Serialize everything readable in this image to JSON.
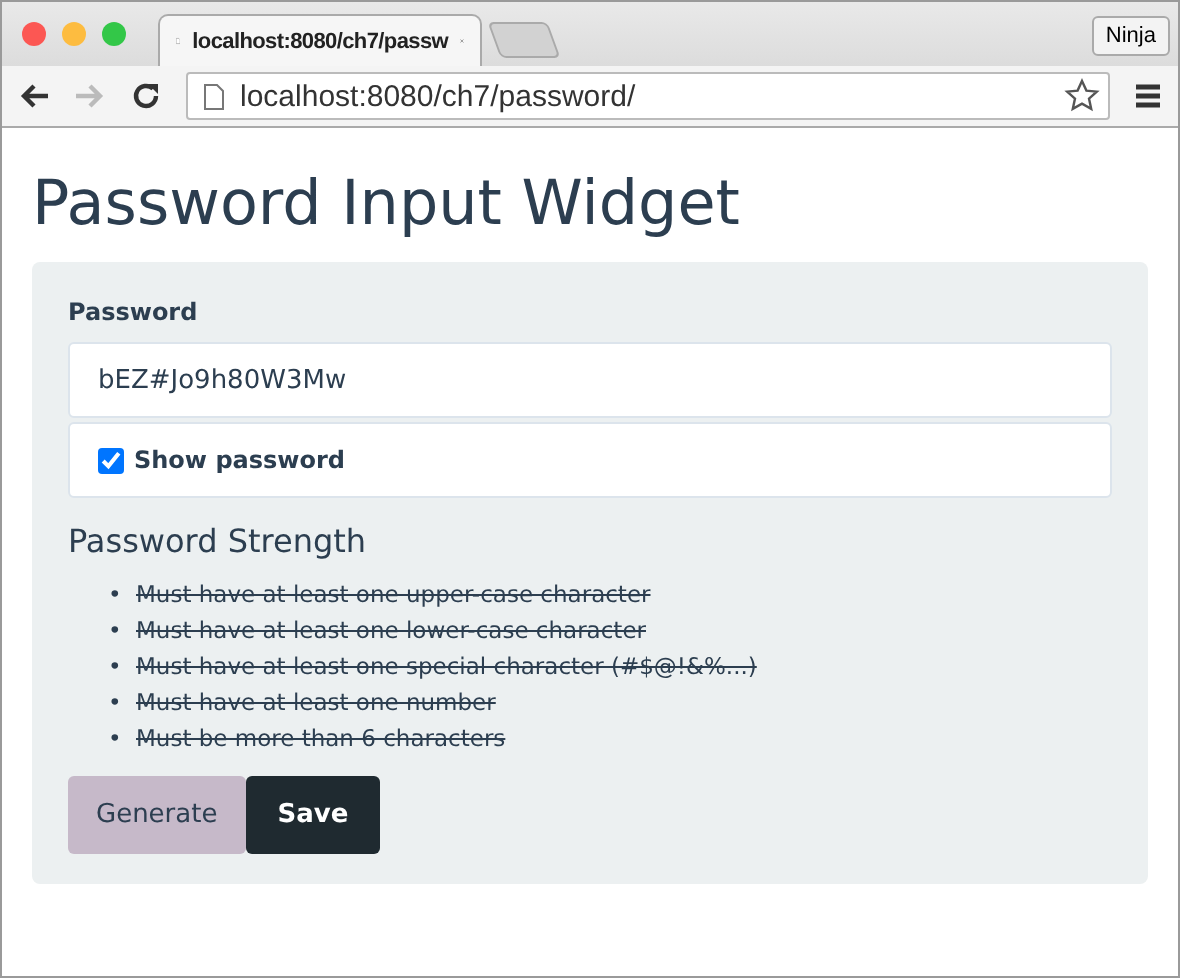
{
  "browser": {
    "tab_title": "localhost:8080/ch7/passw",
    "profile_button": "Ninja",
    "address": "localhost:8080/ch7/password/",
    "forward_disabled": true
  },
  "page": {
    "title": "Password Input Widget",
    "password": {
      "label": "Password",
      "value": "bEZ#Jo9h80W3Mw"
    },
    "show_password": {
      "label": "Show password",
      "checked": true
    },
    "strength": {
      "heading": "Password Strength",
      "rules": [
        {
          "marker": "•",
          "text": "Must have at least one upper-case character",
          "met": true
        },
        {
          "marker": "•",
          "text": "Must have at least one lower-case character",
          "met": true
        },
        {
          "marker": "•",
          "text": "Must have at least one special character (#$@!&%...)",
          "met": true
        },
        {
          "marker": "•",
          "text": "Must have at least one number",
          "met": true
        },
        {
          "marker": "•",
          "text": "Must be more than 6 characters",
          "met": true
        }
      ]
    },
    "buttons": [
      {
        "label": "Generate",
        "kind": "secondary"
      },
      {
        "label": "Save",
        "kind": "primary"
      }
    ]
  }
}
